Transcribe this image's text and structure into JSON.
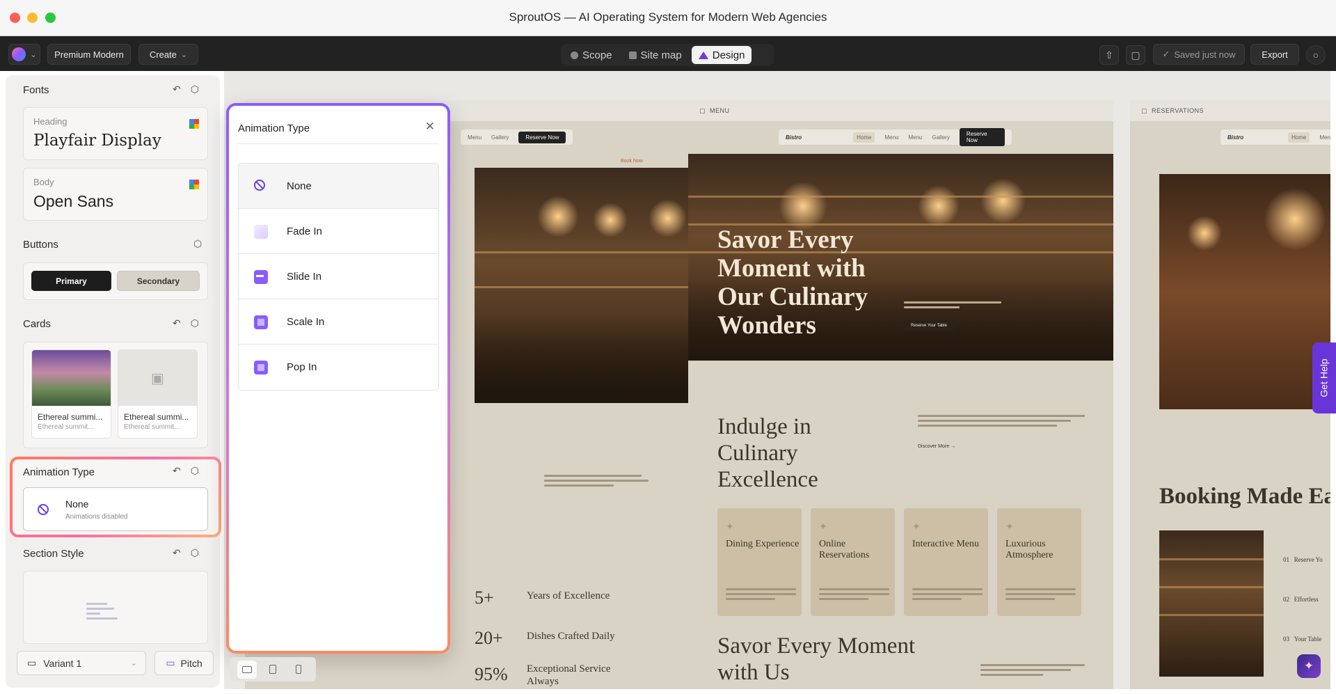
{
  "window": {
    "title": "SproutOS — AI Operating System for Modern Web Agencies"
  },
  "toolbar": {
    "theme_label": "Premium Modern",
    "create_label": "Create",
    "views": [
      {
        "label": "Scope",
        "active": false
      },
      {
        "label": "Site map",
        "active": false
      },
      {
        "label": "Design",
        "active": true
      }
    ],
    "saved_label": "Saved just now",
    "export_label": "Export"
  },
  "left_panel": {
    "fonts": {
      "title": "Fonts",
      "heading": {
        "label": "Heading",
        "value": "Playfair Display"
      },
      "body": {
        "label": "Body",
        "value": "Open Sans"
      }
    },
    "buttons": {
      "title": "Buttons",
      "primary": "Primary",
      "secondary": "Secondary"
    },
    "cards": {
      "title": "Cards",
      "items": [
        {
          "title": "Ethereal summi...",
          "subtitle": "Ethereal summit..."
        },
        {
          "title": "Ethereal summi...",
          "subtitle": "Ethereal summit..."
        }
      ]
    },
    "animation": {
      "title": "Animation Type",
      "value": "None",
      "description": "Animations disabled"
    },
    "section_style": {
      "title": "Section Style"
    },
    "variant_label": "Variant 1",
    "pitch_label": "Pitch"
  },
  "animation_popup": {
    "title": "Animation Type",
    "options": [
      {
        "label": "None",
        "icon": "none-icon",
        "selected": true
      },
      {
        "label": "Fade In",
        "icon": "fade-icon",
        "selected": false
      },
      {
        "label": "Slide In",
        "icon": "slide-icon",
        "selected": false
      },
      {
        "label": "Scale In",
        "icon": "scale-icon",
        "selected": false
      },
      {
        "label": "Pop In",
        "icon": "pop-icon",
        "selected": false
      }
    ]
  },
  "canvas": {
    "frame1": {
      "nav": [
        "Menu",
        "Gallery"
      ],
      "cta": "Reserve Now",
      "book_link": "Book Now",
      "stats": [
        {
          "value": "5+",
          "label": "Years of Excellence"
        },
        {
          "value": "20+",
          "label": "Dishes Crafted Daily"
        },
        {
          "value": "95%",
          "label": "Exceptional Service Always"
        }
      ]
    },
    "frame2": {
      "name": "MENU",
      "brand": "Bistro",
      "nav": [
        "Home",
        "Menu",
        "Menu",
        "Gallery"
      ],
      "cta": "Reserve Now",
      "hero_title": "Savor Every Moment with Our Culinary Wonders",
      "hero_cta": "Reserve Your Table",
      "section_title": "Indulge in Culinary Excellence",
      "discover_link": "Discover More →",
      "features": [
        "Dining Experience",
        "Online Reservations",
        "Interactive Menu",
        "Luxurious Atmosphere"
      ],
      "bottom_title": "Savor Every Moment with Us"
    },
    "frame3": {
      "name": "RESERVATIONS",
      "brand": "Bistro",
      "nav": [
        "Home",
        "Menu"
      ],
      "title": "Booking Made Eas",
      "steps": [
        {
          "num": "01",
          "label": "Reserve Yo"
        },
        {
          "num": "02",
          "label": "Effortless"
        },
        {
          "num": "03",
          "label": "Your Table"
        }
      ]
    }
  },
  "get_help_label": "Get Help",
  "colors": {
    "accent": "#6b3fe0",
    "popup_gradient_top": "#8a5cff",
    "popup_gradient_bottom": "#ff8a62"
  }
}
